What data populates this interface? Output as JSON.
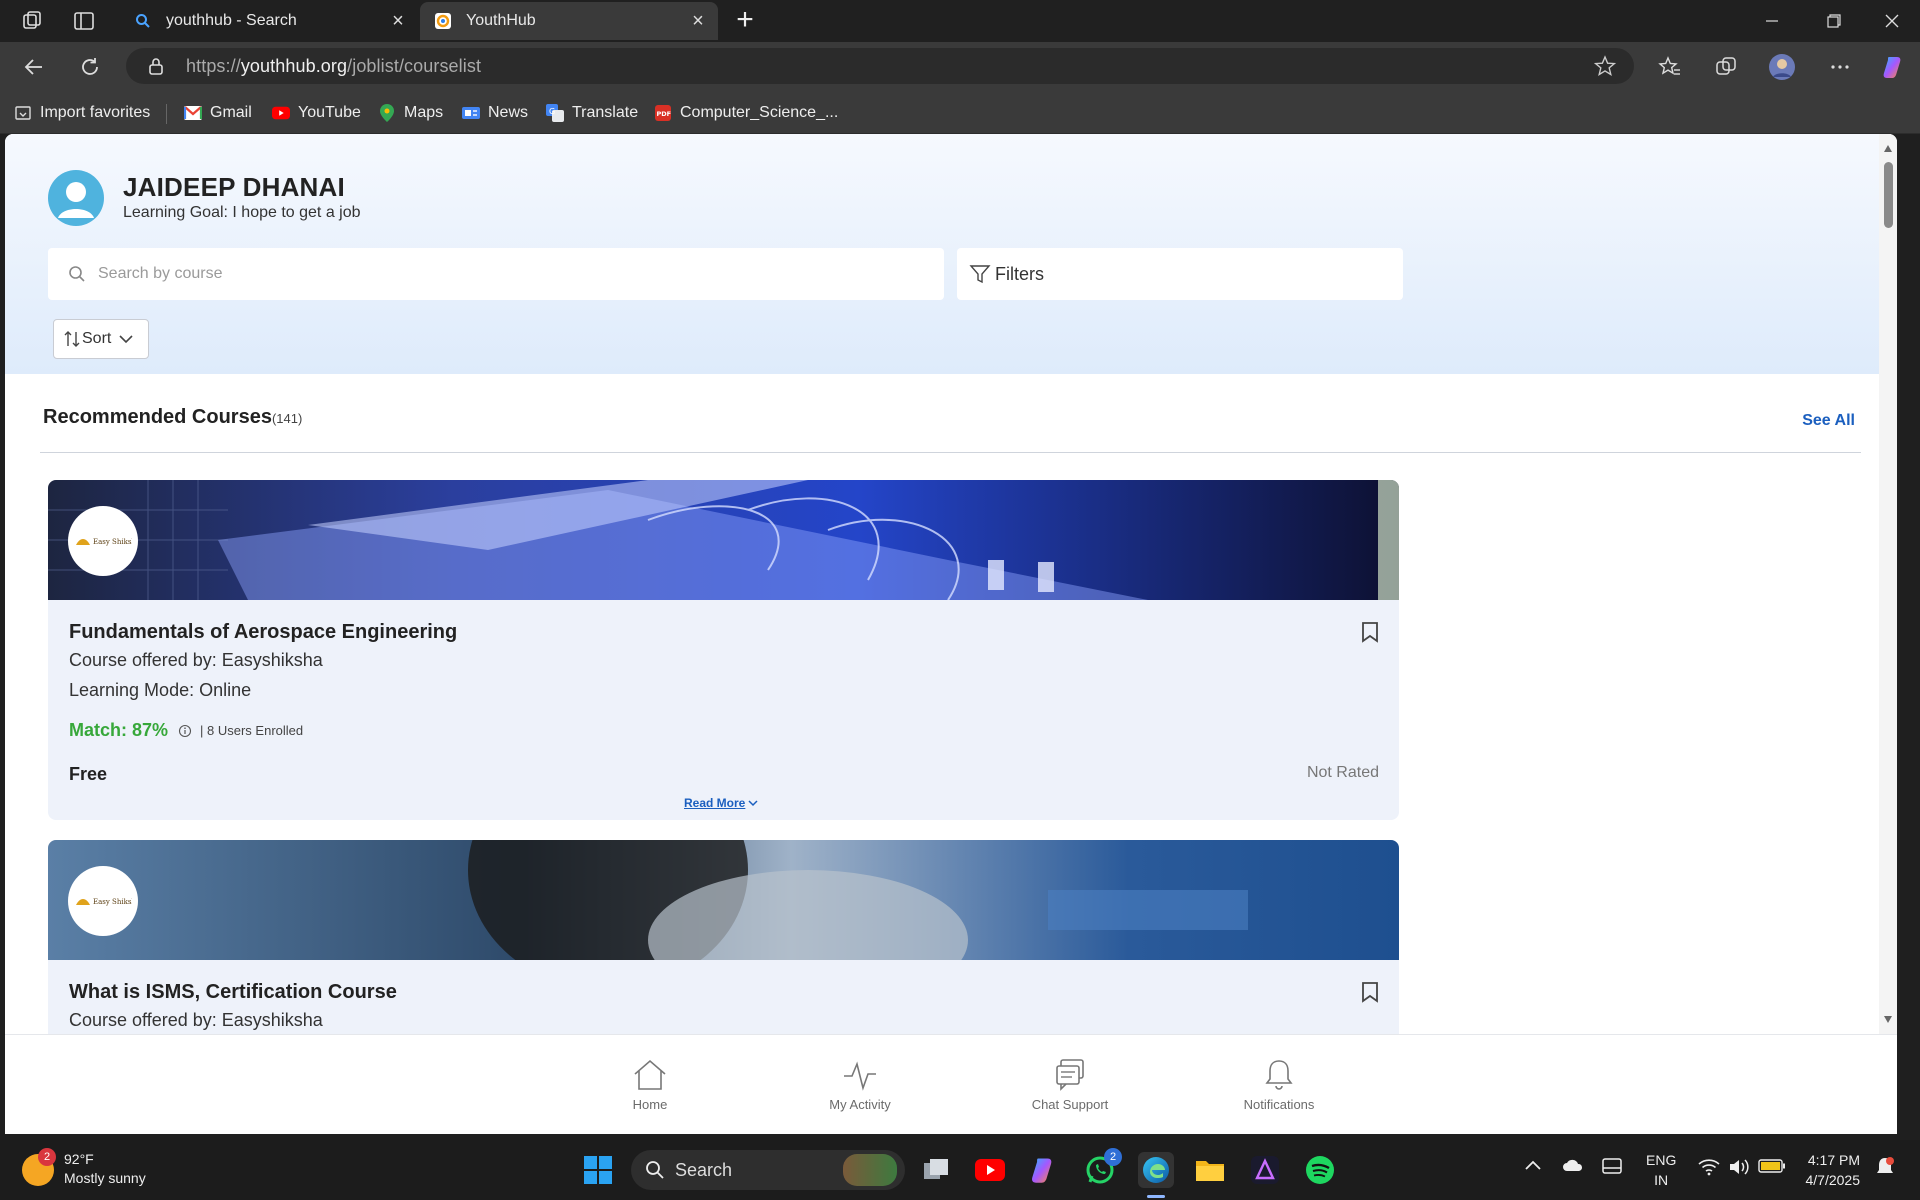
{
  "browser": {
    "tabs": [
      {
        "title": "youthhub - Search",
        "active": false
      },
      {
        "title": "YouthHub",
        "active": true
      }
    ],
    "url_prefix": "https://",
    "url_domain": "youthhub.org",
    "url_path": "/joblist/courselist",
    "bookmarks": [
      "Import favorites",
      "Gmail",
      "YouTube",
      "Maps",
      "News",
      "Translate",
      "Computer_Science_..."
    ]
  },
  "profile": {
    "name": "JAIDEEP DHANAI",
    "goal": "Learning Goal: I hope to get a job"
  },
  "search": {
    "placeholder": "Search by course",
    "value": ""
  },
  "filters": {
    "label": "Filters"
  },
  "sort": {
    "label": "Sort"
  },
  "section": {
    "title": "Recommended Courses",
    "count": "(141)",
    "see_all": "See All"
  },
  "courses": [
    {
      "title": "Fundamentals of Aerospace Engineering",
      "offered_by": "Course offered by: Easyshiksha",
      "mode": "Learning Mode: Online",
      "match": "Match: 87%",
      "enrolled": "| 8 Users Enrolled",
      "price": "Free",
      "rating": "Not Rated",
      "read_more": "Read More",
      "provider_logo_text": "Easy Shiksha"
    },
    {
      "title": "What is ISMS, Certification Course",
      "offered_by": "Course offered by: Easyshiksha",
      "provider_logo_text": "Easy Shiksha"
    }
  ],
  "bottom_nav": [
    {
      "label": "Home",
      "icon": "home-icon"
    },
    {
      "label": "My Activity",
      "icon": "activity-icon"
    },
    {
      "label": "Chat Support",
      "icon": "chat-icon"
    },
    {
      "label": "Notifications",
      "icon": "bell-icon"
    }
  ],
  "taskbar": {
    "weather_temp": "92°F",
    "weather_condition": "Mostly sunny",
    "weather_badge": "2",
    "search_label": "Search",
    "whatsapp_badge": "2",
    "lang_1": "ENG",
    "lang_2": "IN",
    "time": "4:17 PM",
    "date": "4/7/2025"
  },
  "colors": {
    "accent_link": "#1b5fbf",
    "match_green": "#37a83a",
    "card_bg": "#eef2fa"
  }
}
